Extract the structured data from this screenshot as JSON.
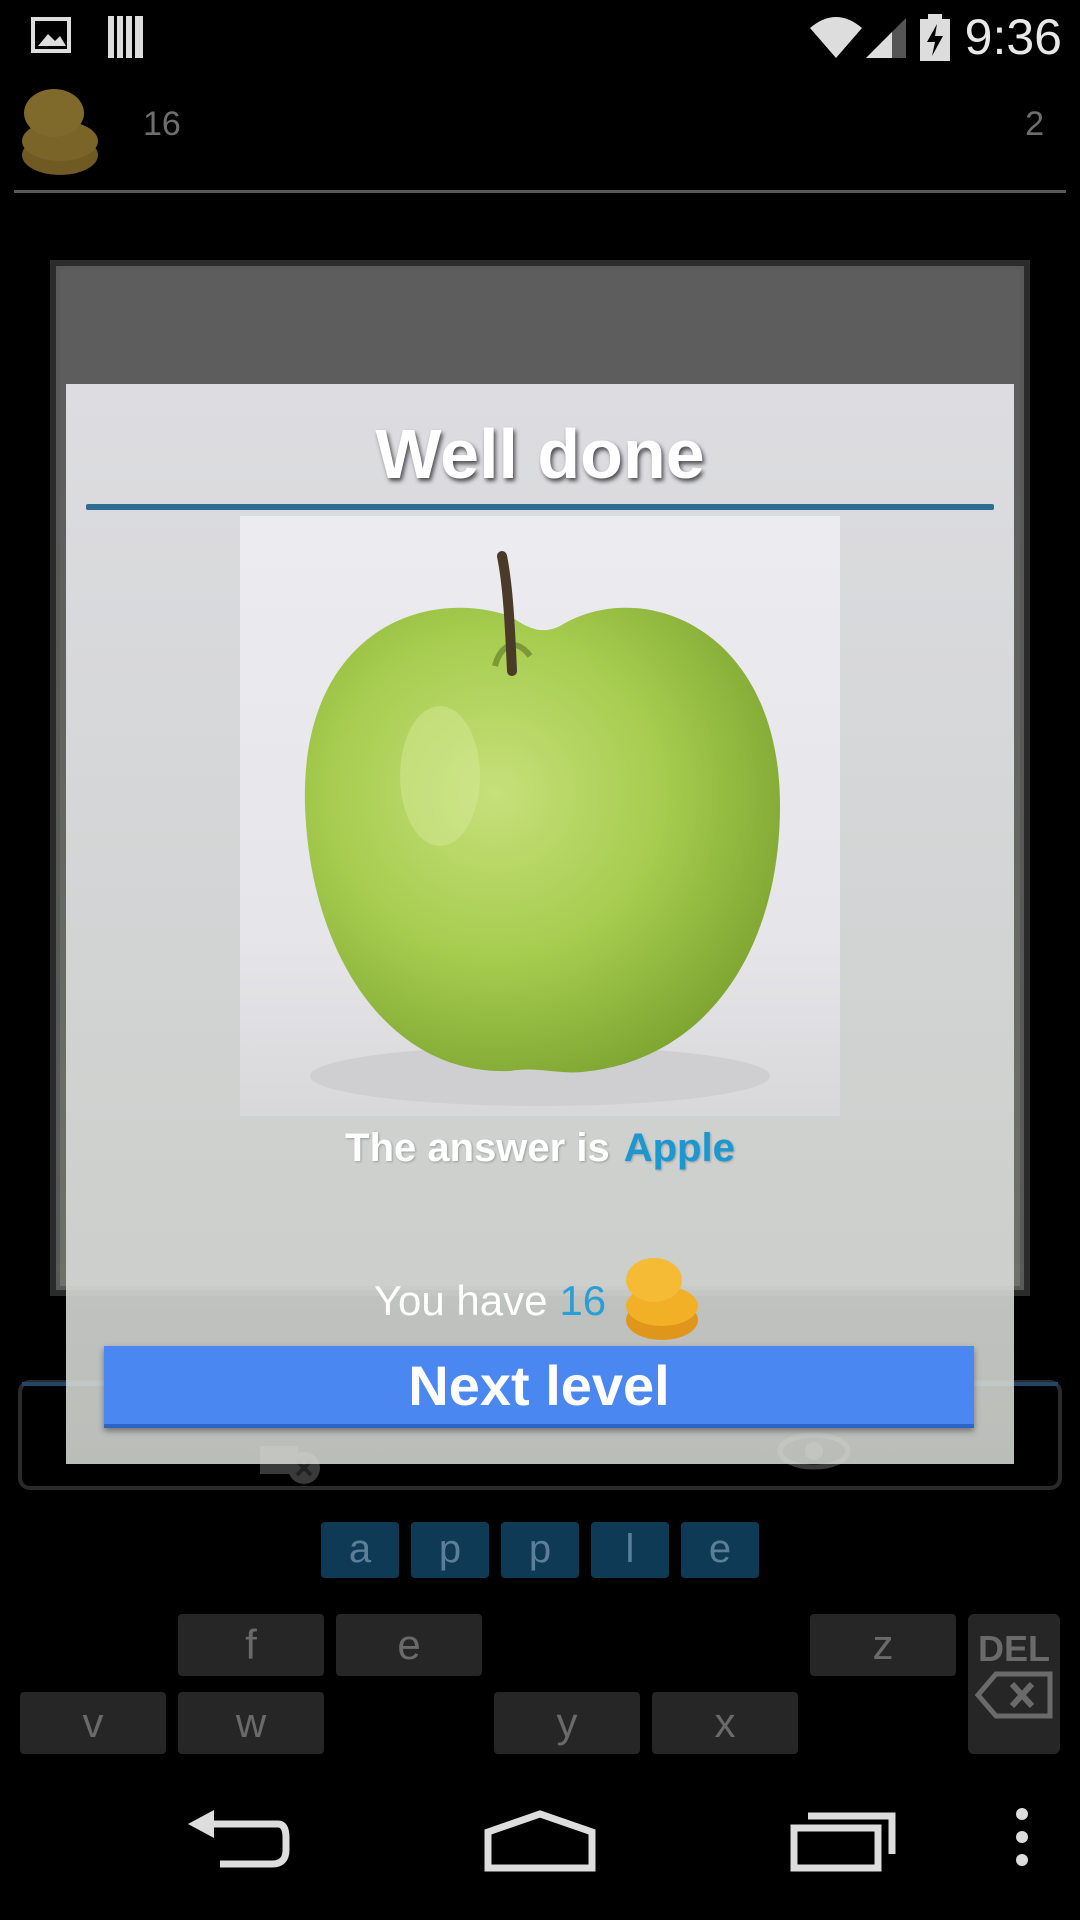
{
  "status_bar": {
    "time": "9:36",
    "icons": [
      "picture-icon",
      "barcode-icon",
      "wifi-icon",
      "signal-icon",
      "battery-charging-icon"
    ]
  },
  "top_bar": {
    "coin_count": "16",
    "level": "2"
  },
  "dialog": {
    "title": "Well done",
    "answer_prefix": "The answer is",
    "answer_word": "Apple",
    "you_have_prefix": "You have",
    "you_have_count": "16",
    "next_button_label": "Next level"
  },
  "answer_letters": [
    "a",
    "p",
    "p",
    "l",
    "e"
  ],
  "keyboard": {
    "row1": [
      "f",
      "e",
      "z"
    ],
    "row2": [
      "v",
      "w",
      "y",
      "x"
    ],
    "del_label": "DEL"
  },
  "nav_bar": {
    "buttons": [
      "back-icon",
      "home-icon",
      "recents-icon",
      "overflow-menu-icon"
    ]
  },
  "colors": {
    "accent_blue": "#1b97d1",
    "button_blue": "#4a87f0",
    "coin_gold": "#f2b027"
  }
}
